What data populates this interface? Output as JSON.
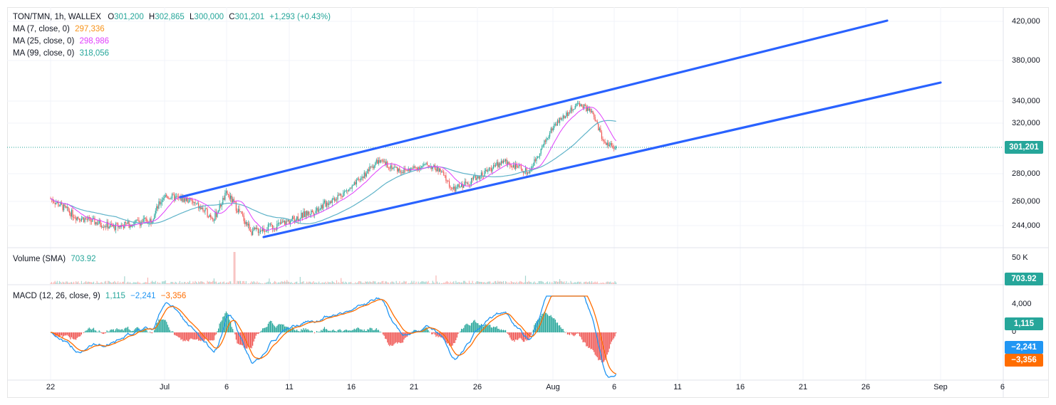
{
  "symbol": "TON/TMN, 1h, WALLEX",
  "ohlc": {
    "o_label": "O",
    "o": "301,200",
    "h_label": "H",
    "h": "302,865",
    "l_label": "L",
    "l": "300,000",
    "c_label": "C",
    "c": "301,201",
    "change": "+1,293 (+0.43%)"
  },
  "ma": [
    {
      "label": "MA (7, close, 0)",
      "value": "297,336",
      "color": "#f7931a"
    },
    {
      "label": "MA (25, close, 0)",
      "value": "298,986",
      "color": "#e040fb"
    },
    {
      "label": "MA (99, close, 0)",
      "value": "318,056",
      "color": "#26a69a"
    }
  ],
  "volume": {
    "label": "Volume (SMA)",
    "value": "703.92",
    "scale_label": "50 K",
    "badge": "703.92"
  },
  "macd": {
    "label": "MACD (12, 26, close, 9)",
    "hist": "1,115",
    "macd": "−2,241",
    "signal": "−3,356",
    "ticks": [
      "4,000",
      "0"
    ],
    "badges": {
      "hist": "1,115",
      "macd": "−2,241",
      "signal": "−3,356"
    }
  },
  "price_axis": {
    "ticks": [
      "420,000",
      "380,000",
      "340,000",
      "320,000",
      "280,000",
      "260,000",
      "244,000"
    ],
    "current_price": "301,201"
  },
  "time_axis": [
    "22",
    "Jul",
    "6",
    "11",
    "16",
    "21",
    "26",
    "Aug",
    "6",
    "11",
    "16",
    "21",
    "26",
    "Sep",
    "6"
  ],
  "colors": {
    "up": "#26a69a",
    "down": "#ef5350",
    "channel": "#2962ff",
    "price_line": "#26a69a",
    "macd_line": "#2196f3",
    "signal_line": "#ff6d00",
    "badge_green": "#26a69a",
    "badge_blue": "#2196f3",
    "badge_orange": "#ff6d00"
  },
  "chart_data": {
    "type": "candlestick",
    "price_min": 230000,
    "price_max": 430000,
    "close_path_keypoints": [
      [
        "Jun 22",
        262000
      ],
      [
        "Jun 24",
        250000
      ],
      [
        "Jun 27",
        243000
      ],
      [
        "Jun 30",
        248000
      ],
      [
        "Jul 1",
        264000
      ],
      [
        "Jul 3",
        261000
      ],
      [
        "Jul 5",
        249000
      ],
      [
        "Jul 6",
        266000
      ],
      [
        "Jul 8",
        240000
      ],
      [
        "Jul 10",
        244000
      ],
      [
        "Jul 13",
        254000
      ],
      [
        "Jul 16",
        270000
      ],
      [
        "Jul 18",
        290000
      ],
      [
        "Jul 20",
        282000
      ],
      [
        "Jul 22",
        287000
      ],
      [
        "Jul 23",
        282000
      ],
      [
        "Jul 24",
        268000
      ],
      [
        "Jul 26",
        278000
      ],
      [
        "Jul 28",
        290000
      ],
      [
        "Jul 30",
        281000
      ],
      [
        "Aug 1",
        318000
      ],
      [
        "Aug 3",
        338000
      ],
      [
        "Aug 4",
        330000
      ],
      [
        "Aug 5",
        305000
      ],
      [
        "Aug 6",
        301201
      ]
    ]
  }
}
